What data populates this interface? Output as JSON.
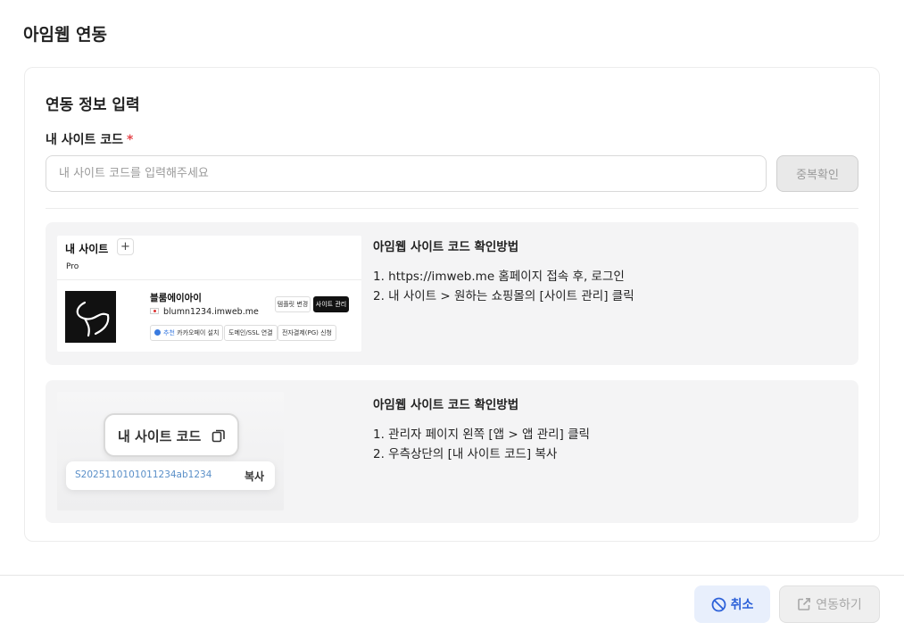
{
  "modal": {
    "title": "아임웹 연동"
  },
  "form": {
    "section_title": "연동 정보 입력",
    "field_label": "내 사이트 코드",
    "required_mark": "*",
    "input_placeholder": "내 사이트 코드를 입력해주세요",
    "input_value": "",
    "duplicate_check_label": "중복확인"
  },
  "guide1": {
    "title": "아임웹 사이트 코드 확인방법",
    "steps": [
      "1. https://imweb.me 홈페이지 접속 후, 로그인",
      "2. 내 사이트 > 원하는 쇼핑몰의 [사이트 관리] 클릭"
    ],
    "screenshot": {
      "title": "내 사이트",
      "plus": "+",
      "plan": "Pro",
      "site_name": "블룸에이아이",
      "site_url": "blumn1234.imweb.me",
      "btn_connect": "템플릿 변경",
      "btn_manage": "사이트 관리",
      "chip_recommend": "추천",
      "chip1": "카카오페이 설치",
      "chip2": "도메인/SSL 연결",
      "chip3": "전자결제(PG) 신청"
    }
  },
  "guide2": {
    "title": "아임웹 사이트 코드 확인방법",
    "steps": [
      "1. 관리자 페이지 왼쪽 [앱 > 앱 관리] 클릭",
      "2. 우측상단의 [내 사이트 코드] 복사"
    ],
    "screenshot": {
      "pill_label": "내 사이트 코드",
      "code": "S2025110101011234ab1234",
      "copy_label": "복사"
    }
  },
  "footer": {
    "cancel_label": "취소",
    "connect_label": "연동하기"
  },
  "colors": {
    "required": "#e5484d",
    "cancel_bg": "#e8effc",
    "cancel_text": "#2e62d9",
    "guide_bg": "#f4f4f5"
  },
  "icons": {
    "cancel": "ban-icon",
    "connect": "external-link-icon",
    "copy": "copy-icon"
  }
}
